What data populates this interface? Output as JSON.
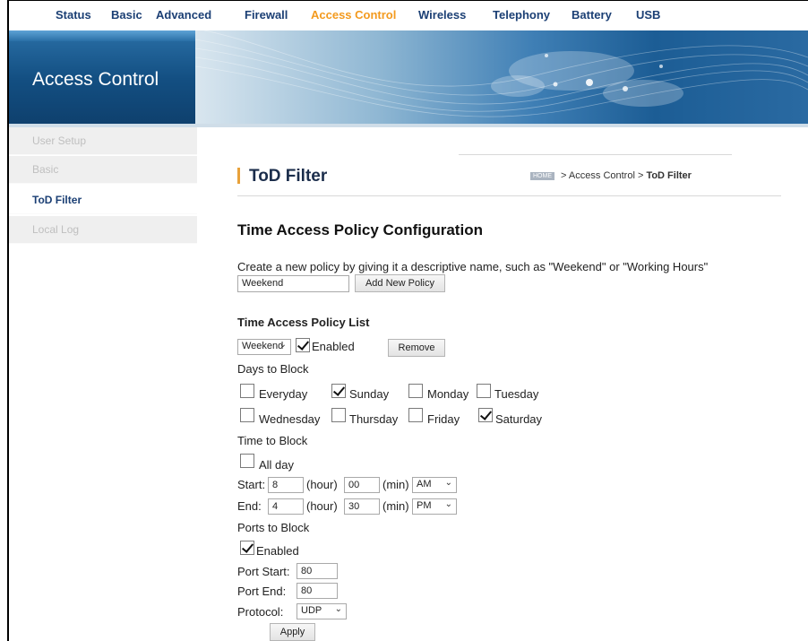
{
  "nav": {
    "items": [
      "Status",
      "Basic",
      "Advanced",
      "Firewall",
      "Access Control",
      "Wireless",
      "Telephony",
      "Battery",
      "USB"
    ],
    "active": "Access Control"
  },
  "banner": {
    "title": "Access Control"
  },
  "sidebar": {
    "items": [
      "User Setup",
      "Basic",
      "ToD Filter",
      "Local Log"
    ],
    "active": "ToD Filter"
  },
  "page": {
    "title": "ToD Filter",
    "breadcrumb": {
      "home": "HOME",
      "path": " > Access Control > ",
      "current": "ToD Filter"
    }
  },
  "config": {
    "section_title": "Time Access Policy Configuration",
    "description": "Create a new policy by giving it a descriptive name, such as \"Weekend\" or \"Working Hours\"",
    "policy_name_value": "Weekend",
    "add_button": "Add New Policy"
  },
  "list": {
    "title": "Time Access Policy List",
    "selected_policy": "Weekend",
    "enabled_label": "Enabled",
    "enabled": true,
    "remove_button": "Remove"
  },
  "days": {
    "label": "Days to Block",
    "items": [
      {
        "label": "Everyday",
        "checked": false
      },
      {
        "label": "Sunday",
        "checked": true
      },
      {
        "label": "Monday",
        "checked": false
      },
      {
        "label": "Tuesday",
        "checked": false
      },
      {
        "label": "Wednesday",
        "checked": false
      },
      {
        "label": "Thursday",
        "checked": false
      },
      {
        "label": "Friday",
        "checked": false
      },
      {
        "label": "Saturday",
        "checked": true
      }
    ]
  },
  "time": {
    "label": "Time to Block",
    "all_day_label": "All day",
    "all_day": false,
    "start_label": "Start:",
    "start_hour": "8",
    "start_min": "00",
    "start_ampm": "AM",
    "end_label": "End:",
    "end_hour": "4",
    "end_min": "30",
    "end_ampm": "PM",
    "hour_unit": "(hour)",
    "min_unit": "(min)"
  },
  "ports": {
    "label": "Ports to Block",
    "enabled_label": "Enabled",
    "enabled": true,
    "start_label": "Port Start:",
    "start_value": "80",
    "end_label": "Port End:",
    "end_value": "80",
    "protocol_label": "Protocol:",
    "protocol_value": "UDP"
  },
  "apply_button": "Apply",
  "colors": {
    "nav": "#1b3f74",
    "active": "#f39a1e",
    "accent": "#e8a13a"
  }
}
